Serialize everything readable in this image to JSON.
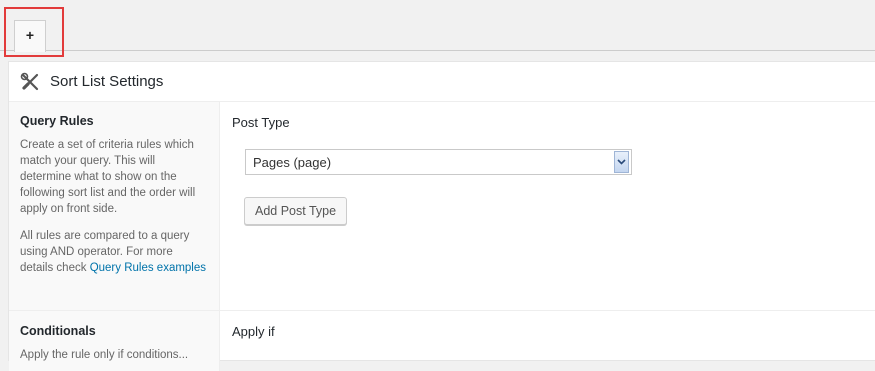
{
  "tabs": {
    "add_label": "+"
  },
  "panel": {
    "title": "Sort List Settings",
    "icon": "wrench-screwdriver-icon"
  },
  "query_rules": {
    "title": "Query Rules",
    "desc1": "Create a set of criteria rules which match your query. This will determine what to show on the following sort list and the order will apply on front side.",
    "desc2_prefix": "All rules are compared to a query using AND operator. For more details check ",
    "desc2_link": "Query Rules examples"
  },
  "post_type": {
    "label": "Post Type",
    "selected": "Pages (page)",
    "add_button": "Add Post Type"
  },
  "conditionals": {
    "title": "Conditionals",
    "desc_cut": "Apply the rule only if conditions...",
    "apply_if_label": "Apply if"
  },
  "colors": {
    "highlight": "#e23b3b",
    "link": "#0073aa"
  }
}
